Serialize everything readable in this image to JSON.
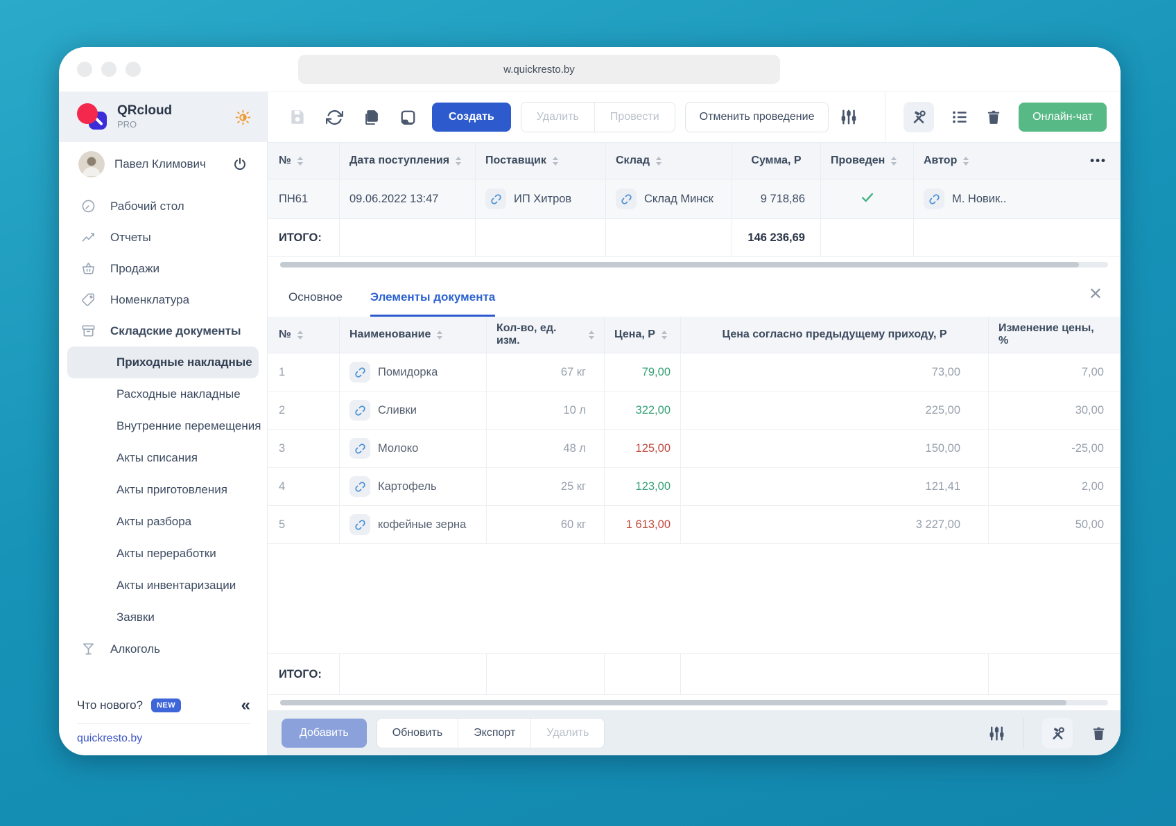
{
  "browser": {
    "url": "w.quickresto.by"
  },
  "brand": {
    "name": "QRcloud",
    "plan": "PRO"
  },
  "user": {
    "name": "Павел Климович"
  },
  "nav": {
    "items": [
      "Рабочий стол",
      "Отчеты",
      "Продажи",
      "Номенклатура",
      "Складские документы"
    ],
    "sub_items": [
      "Приходные накладные",
      "Расходные накладные",
      "Внутренние перемещения",
      "Акты списания",
      "Акты приготовления",
      "Акты разбора",
      "Акты переработки",
      "Акты инвентаризации",
      "Заявки"
    ],
    "alcohol": "Алкоголь"
  },
  "sidebar_footer": {
    "whats_new": "Что нового?",
    "badge": "NEW",
    "collapse_glyph": "«",
    "site": "quickresto.by"
  },
  "toolbar": {
    "create": "Создать",
    "delete": "Удалить",
    "post": "Провести",
    "unpost": "Отменить проведение",
    "chat": "Онлайн-чат"
  },
  "documents_table": {
    "columns": {
      "num": "№",
      "date": "Дата поступления",
      "supplier": "Поставщик",
      "warehouse": "Склад",
      "sum": "Сумма, Р",
      "posted": "Проведен",
      "author": "Автор"
    },
    "more_glyph": "•••",
    "row": {
      "num": "ПН61",
      "date": "09.06.2022 13:47",
      "supplier": "ИП Хитров",
      "warehouse": "Склад Минск",
      "sum": "9 718,86",
      "posted": true,
      "author": "М. Новик.."
    },
    "total_label": "ИТОГО:",
    "total_sum": "146 236,69"
  },
  "tabs": {
    "main": "Основное",
    "elements": "Элементы документа",
    "close_glyph": "✕"
  },
  "elements_table": {
    "columns": {
      "num": "№",
      "name": "Наименование",
      "qty": "Кол-во, ед. изм.",
      "price": "Цена, Р",
      "prev_price": "Цена согласно предыдущему приходу, Р",
      "change": "Изменение цены, %"
    },
    "rows": [
      {
        "num": "1",
        "name": "Помидорка",
        "qty": "67 кг",
        "price": "79,00",
        "price_color": "green",
        "prev_price": "73,00",
        "change": "7,00"
      },
      {
        "num": "2",
        "name": "Сливки",
        "qty": "10 л",
        "price": "322,00",
        "price_color": "green",
        "prev_price": "225,00",
        "change": "30,00"
      },
      {
        "num": "3",
        "name": "Молоко",
        "qty": "48 л",
        "price": "125,00",
        "price_color": "red",
        "prev_price": "150,00",
        "change": "-25,00"
      },
      {
        "num": "4",
        "name": "Картофель",
        "qty": "25 кг",
        "price": "123,00",
        "price_color": "green",
        "prev_price": "121,41",
        "change": "2,00"
      },
      {
        "num": "5",
        "name": "кофейные зерна",
        "qty": "60 кг",
        "price": "1 613,00",
        "price_color": "red",
        "prev_price": "3 227,00",
        "change": "50,00"
      }
    ],
    "total_label": "ИТОГО:"
  },
  "footer_toolbar": {
    "add": "Добавить",
    "refresh": "Обновить",
    "export": "Экспорт",
    "delete": "Удалить"
  },
  "colors": {
    "accent_blue": "#2d5bce",
    "tab_blue": "#2c63cf",
    "chat_green": "#57b985",
    "check_green": "#44b07f",
    "price_up_green": "#36a077",
    "price_down_red": "#c24b40",
    "badge_blue": "#3e66d8",
    "frame_teal": "#1793b8",
    "link_icon_blue": "#4a8fd4",
    "add_button_blue": "#8ba1db"
  }
}
